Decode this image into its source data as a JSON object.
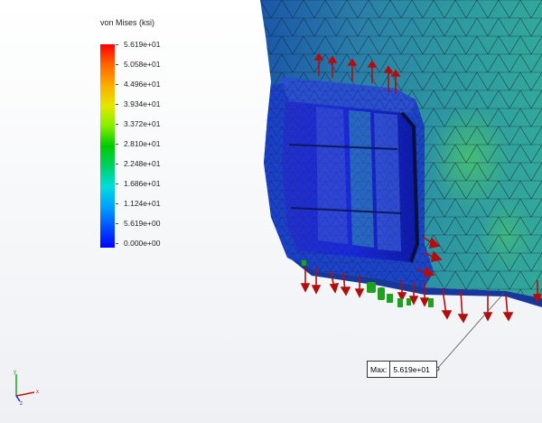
{
  "legend": {
    "title": "von Mises (ksi)",
    "ticks": [
      "5.619e+01",
      "5.058e+01",
      "4.496e+01",
      "3.934e+01",
      "3.372e+01",
      "2.810e+01",
      "2.248e+01",
      "1.686e+01",
      "1.124e+01",
      "5.619e+00",
      "0.000e+00"
    ]
  },
  "probe": {
    "key": "Max:",
    "value": "5.619e+01"
  },
  "colors": {
    "load_arrow": "#b30d0d",
    "fixture": "#1fa11f",
    "mesh_edge": "#0a1a2a"
  },
  "triad": {
    "x": "x",
    "y": "y",
    "z": "z"
  }
}
